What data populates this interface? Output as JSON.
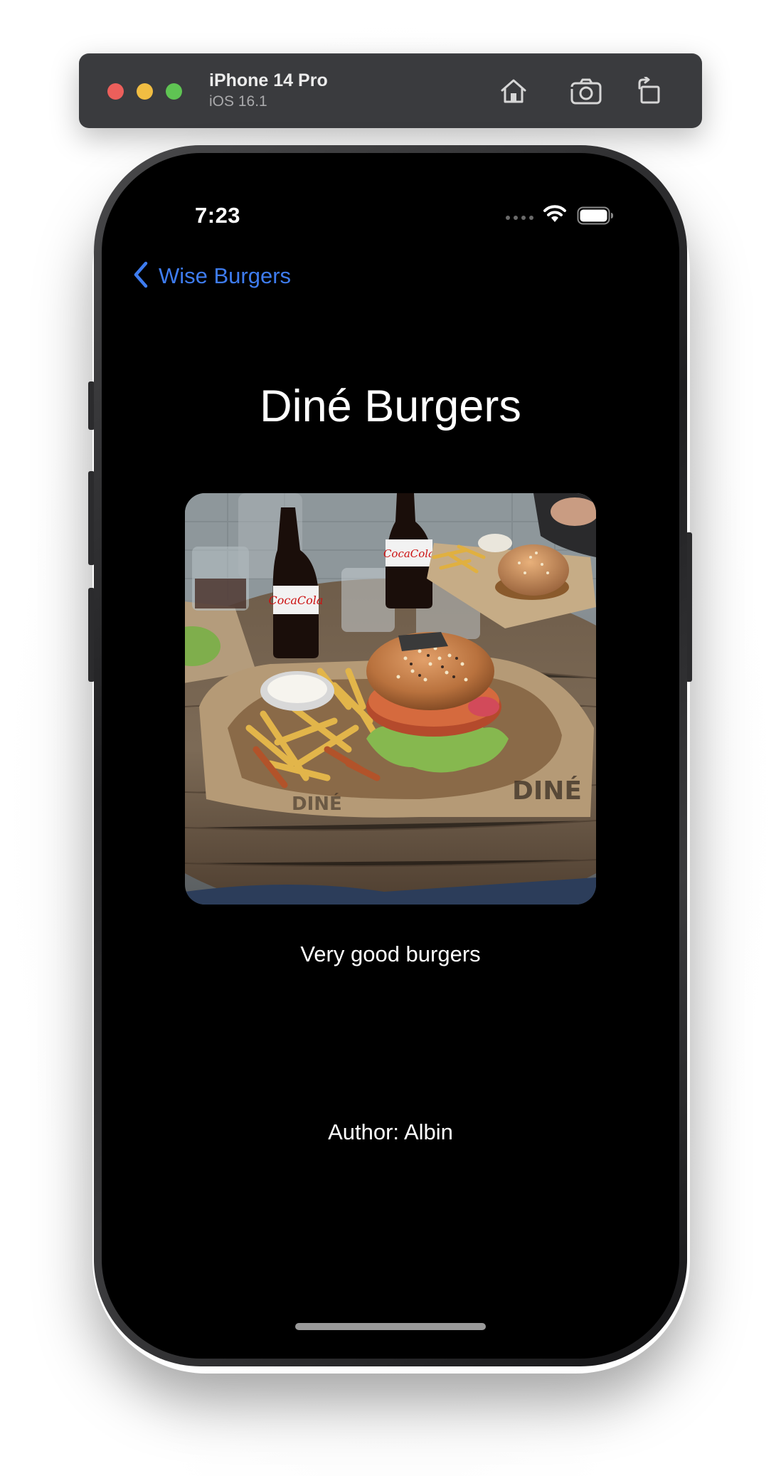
{
  "simulator": {
    "device_name": "iPhone 14 Pro",
    "os_version": "iOS 16.1",
    "toolbar_icons": [
      "home-icon",
      "screenshot-icon",
      "rotate-icon"
    ]
  },
  "status_bar": {
    "time": "7:23",
    "icons": [
      "cellular-dots-icon",
      "wifi-icon",
      "battery-icon"
    ]
  },
  "nav": {
    "back_label": "Wise Burgers",
    "back_icon": "chevron-left-icon"
  },
  "content": {
    "title": "Diné Burgers",
    "photo_icon": "burger-photo",
    "description": "Very good burgers",
    "author": "Author: Albin"
  },
  "colors": {
    "accent": "#3e7cf0",
    "background": "#000000",
    "text": "#ffffff"
  }
}
